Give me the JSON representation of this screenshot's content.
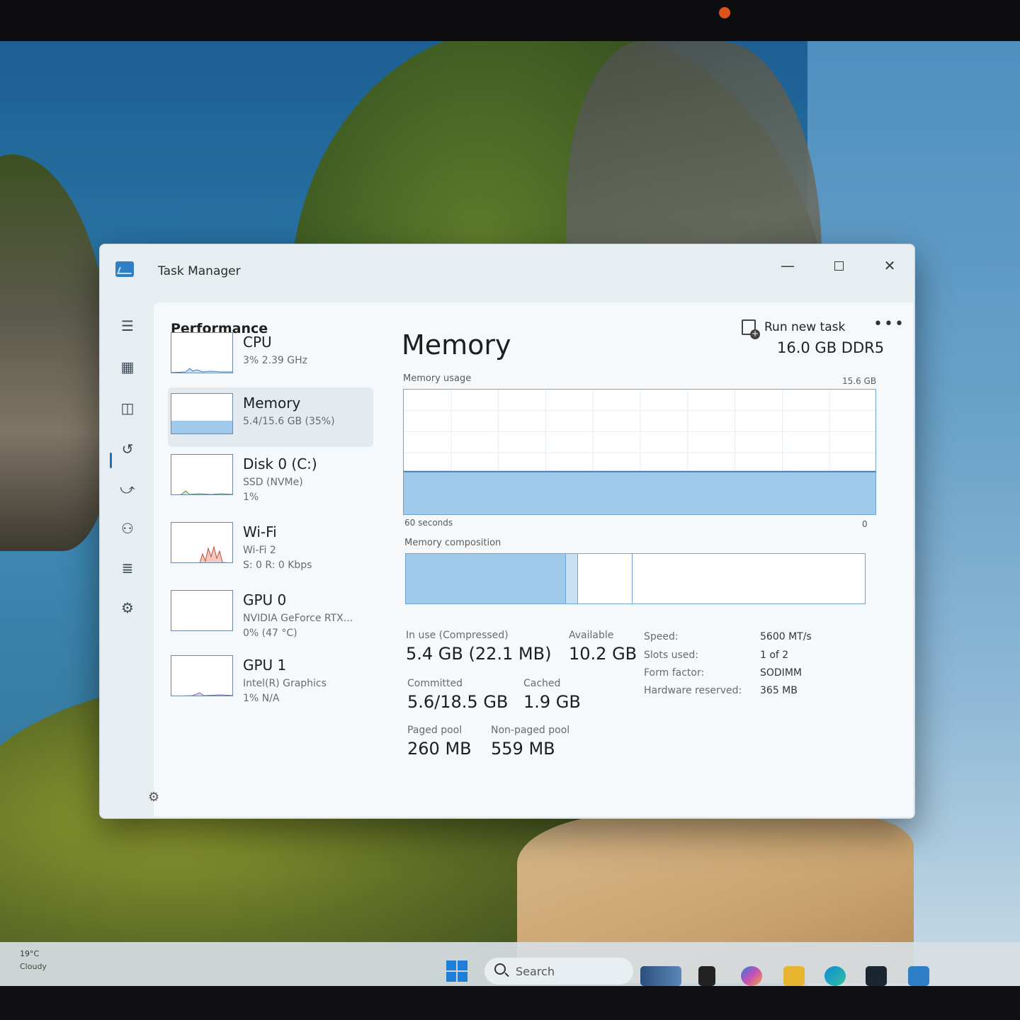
{
  "window": {
    "title": "Task Manager",
    "minimize_glyph": "—",
    "close_glyph": "✕"
  },
  "sidebar": {
    "icons": [
      "hamburger-icon",
      "processes-icon",
      "performance-icon",
      "app-history-icon",
      "startup-apps-icon",
      "users-icon",
      "details-icon",
      "services-icon",
      "settings-icon"
    ],
    "active": "performance-icon"
  },
  "header": {
    "title": "Performance",
    "run_new_task": "Run new task",
    "more": "•••"
  },
  "resources": [
    {
      "name": "CPU",
      "sub1": "3% 2.39 GHz",
      "sub2": "",
      "sub3": ""
    },
    {
      "name": "Memory",
      "sub1": "5.4/15.6 GB (35%)",
      "sub2": "",
      "sub3": ""
    },
    {
      "name": "Disk 0 (C:)",
      "sub1": "SSD (NVMe)",
      "sub2": "1%",
      "sub3": ""
    },
    {
      "name": "Wi-Fi",
      "sub1": "Wi-Fi 2",
      "sub2": "S: 0 R: 0 Kbps",
      "sub3": ""
    },
    {
      "name": "GPU 0",
      "sub1": "NVIDIA GeForce RTX...",
      "sub2": "0% (47 °C)",
      "sub3": ""
    },
    {
      "name": "GPU 1",
      "sub1": "Intel(R) Graphics",
      "sub2": "1% N/A",
      "sub3": ""
    }
  ],
  "selected_resource": "Memory",
  "detail": {
    "title": "Memory",
    "spec": "16.0 GB DDR5",
    "usage_label": "Memory usage",
    "usage_max": "15.6 GB",
    "usage_fraction": 0.35,
    "x_left": "60 seconds",
    "x_right": "0",
    "composition_label": "Memory composition",
    "composition": {
      "in_use_fraction": 0.35,
      "modified_fraction": 0.025,
      "standby_fraction": 0.12
    },
    "stats": {
      "in_use_label": "In use (Compressed)",
      "in_use_value": "5.4 GB (22.1 MB)",
      "available_label": "Available",
      "available_value": "10.2 GB",
      "committed_label": "Committed",
      "committed_value": "5.6/18.5 GB",
      "cached_label": "Cached",
      "cached_value": "1.9 GB",
      "paged_label": "Paged pool",
      "paged_value": "260 MB",
      "nonpaged_label": "Non-paged pool",
      "nonpaged_value": "559 MB"
    },
    "specs": [
      {
        "key": "Speed:",
        "value": "5600 MT/s"
      },
      {
        "key": "Slots used:",
        "value": "1 of 2"
      },
      {
        "key": "Form factor:",
        "value": "SODIMM"
      },
      {
        "key": "Hardware reserved:",
        "value": "365 MB"
      }
    ]
  },
  "taskbar": {
    "weather_temp": "19°C",
    "weather_desc": "Cloudy",
    "search_placeholder": "Search",
    "apps": [
      "widgets-icon",
      "task-view-icon",
      "copilot-icon",
      "file-explorer-icon",
      "edge-icon",
      "store-icon",
      "task-manager-icon"
    ]
  },
  "colors": {
    "accent": "#1f6fbf",
    "memory_fill": "#9fcaeb",
    "memory_line": "#6fa3d1",
    "window_bg": "#f5f9fb"
  }
}
